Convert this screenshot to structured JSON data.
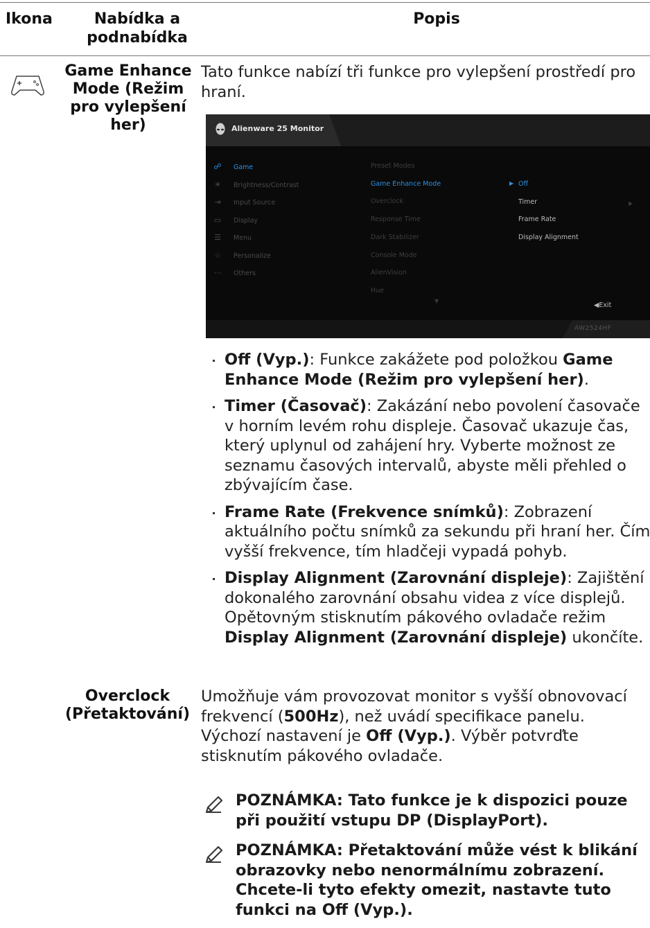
{
  "table_header": {
    "col_icon": "Ikona",
    "col_menu": "Nabídka a podnabídka",
    "col_desc": "Popis"
  },
  "rows": {
    "game_enhance": {
      "menu_name": "Game Enhance Mode (Režim pro vylepšení her)",
      "icon": "gamepad-icon",
      "intro": "Tato funkce nabízí tři funkce pro vylepšení prostředí pro hraní.",
      "bullets": [
        {
          "term": "Off (Vyp.)",
          "sep": ": ",
          "text": "Funkce zakážete pod položkou ",
          "term2": "Game Enhance Mode (Režim pro vylepšení her)",
          "tail": "."
        },
        {
          "term": "Timer (Časovač)",
          "sep": ": ",
          "text": "Zakázání nebo povolení časovače v horním levém rohu displeje. Časovač ukazuje čas, který uplynul od zahájení hry. Vyberte možnost ze seznamu časových intervalů, abyste měli přehled o zbývajícím čase."
        },
        {
          "term": "Frame Rate (Frekvence snímků)",
          "sep": ": ",
          "text": "Zobrazení aktuálního počtu snímků za sekundu při hraní her. Čím vyšší frekvence, tím hladčeji vypadá pohyb."
        },
        {
          "term": "Display Alignment (Zarovnání displeje)",
          "sep": ": ",
          "text": "Zajištění dokonalého zarovnání obsahu videa z více displejů. Opětovným stisknutím pákového ovladače režim ",
          "term2": "Display Alignment (Zarovnání displeje)",
          "tail": " ukončíte."
        }
      ]
    },
    "overclock": {
      "menu_name": "Overclock (Přetaktování)",
      "desc_a": "Umožňuje vám provozovat monitor s vyšší obnovovací frekvencí (",
      "desc_b": "500Hz",
      "desc_c": "), než uvádí specifikace panelu. Výchozí nastavení je ",
      "desc_d": "Off (Vyp.)",
      "desc_e": ". Výběr potvrďte stisknutím pákového ovladače.",
      "notes": [
        "POZNÁMKA: Tato funkce je k dispozici pouze při použití vstupu DP (DisplayPort).",
        "POZNÁMKA: Přetaktování může vést k blikání obrazovky nebo nenormálnímu zobrazení. Chcete-li tyto efekty omezit, nastavte tuto funkci na Off (Vyp.)."
      ]
    }
  },
  "osd": {
    "title": "Alienware 25 Monitor",
    "model": "AW2524HF",
    "accent": "#2f8fe0",
    "left_menu": [
      {
        "icon": "game-icon",
        "glyph": "☍",
        "label": "Game",
        "active": true
      },
      {
        "icon": "brightness-icon",
        "glyph": "☀",
        "label": "Brightness/Contrast",
        "active": false
      },
      {
        "icon": "input-source-icon",
        "glyph": "⇥",
        "label": "Input Source",
        "active": false
      },
      {
        "icon": "display-icon",
        "glyph": "▭",
        "label": "Display",
        "active": false
      },
      {
        "icon": "menu-icon",
        "glyph": "☰",
        "label": "Menu",
        "active": false
      },
      {
        "icon": "personalize-icon",
        "glyph": "☆",
        "label": "Personalize",
        "active": false
      },
      {
        "icon": "others-icon",
        "glyph": "⋯",
        "label": "Others",
        "active": false
      }
    ],
    "mid_menu": [
      {
        "label": "Preset Modes",
        "active": false
      },
      {
        "label": "Game Enhance Mode",
        "active": true
      },
      {
        "label": "Overclock",
        "active": false
      },
      {
        "label": "Response Time",
        "active": false
      },
      {
        "label": "Dark Stabilizer",
        "active": false
      },
      {
        "label": "Console Mode",
        "active": false
      },
      {
        "label": "AlienVision",
        "active": false
      },
      {
        "label": "Hue",
        "active": false
      }
    ],
    "right_menu": [
      {
        "label": "Off",
        "active": true
      },
      {
        "label": "Timer",
        "active": false
      },
      {
        "label": "Frame Rate",
        "active": false
      },
      {
        "label": "Display Alignment",
        "active": false
      }
    ],
    "exit_label": "Exit"
  }
}
